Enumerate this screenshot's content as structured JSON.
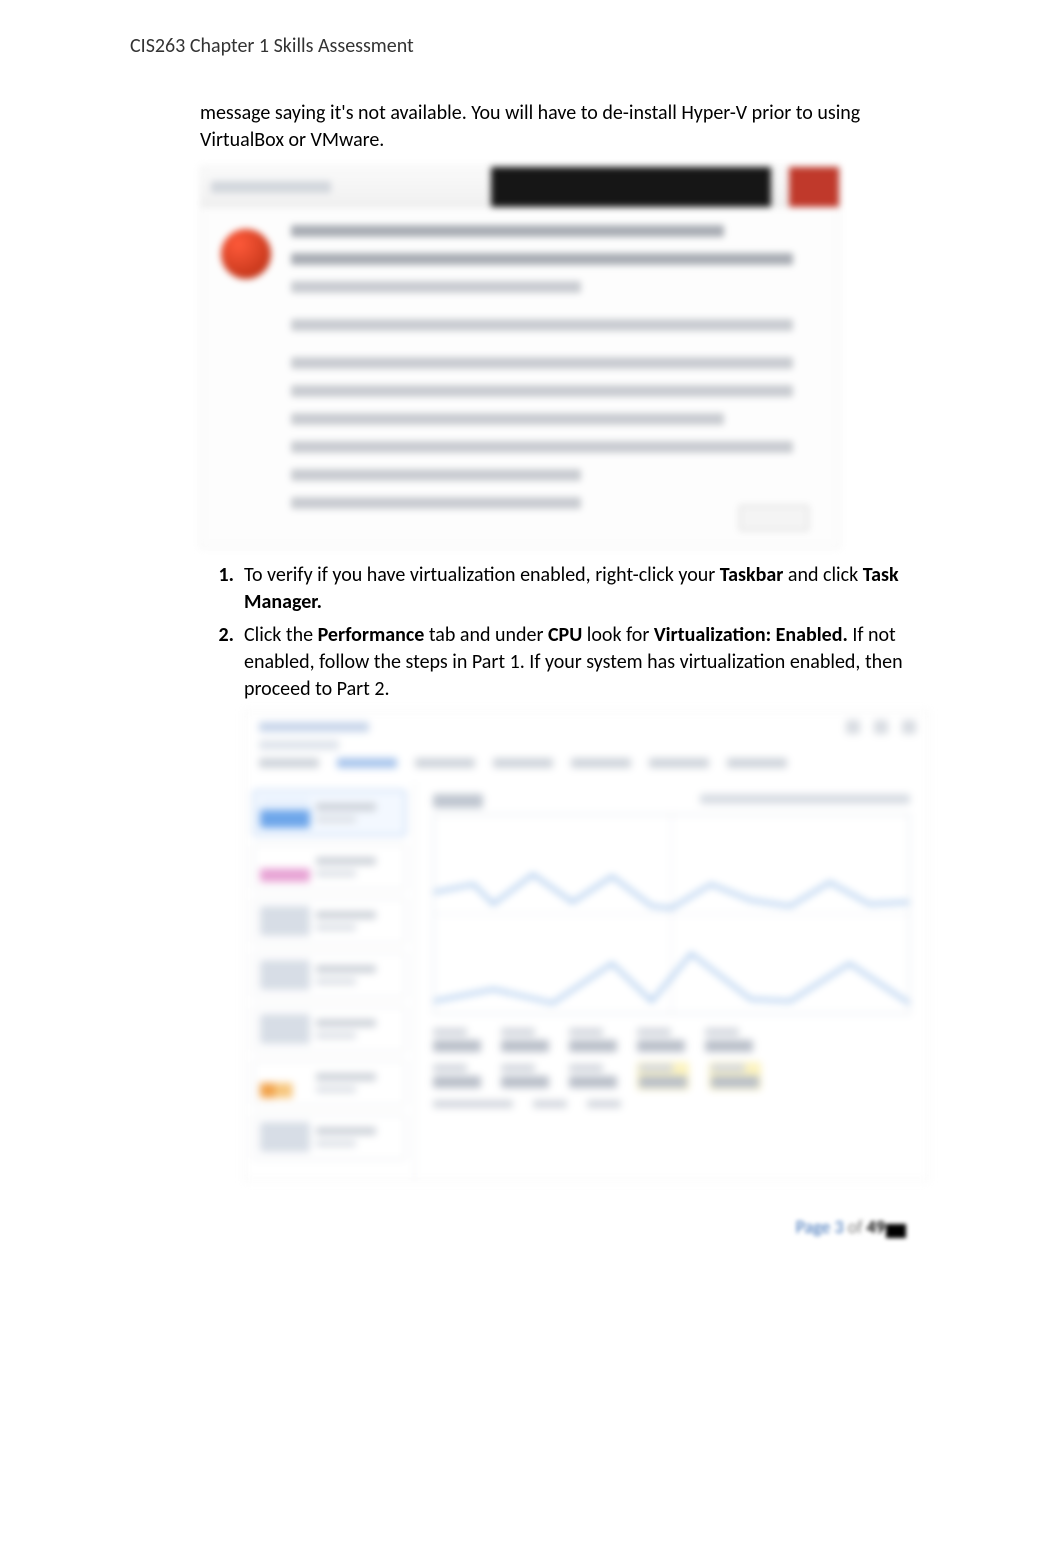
{
  "header": {
    "title": "CIS263 Chapter 1 Skills Assessment"
  },
  "intro": {
    "line": "message saying it's not available. You will have to de-install Hyper-V prior to using VirtualBox or VMware."
  },
  "steps": [
    {
      "num": "1.",
      "pre": "To verify if you have virtualization enabled, right-click your ",
      "b1": "Taskbar",
      "mid": " and click ",
      "b2": "Task Manager.",
      "post": ""
    },
    {
      "num": "2.",
      "pre": "Click the ",
      "b1": "Performance",
      "mid": " tab and under ",
      "b2": "CPU",
      "mid2": " look for ",
      "b3": "Virtualization: Enabled.",
      "post": " If not enabled, follow the steps in Part 1. If your system has virtualization enabled, then proceed to Part 2."
    }
  ],
  "footer": {
    "page_label": "Page",
    "page_num": "3",
    "of": "of",
    "total": "49"
  }
}
